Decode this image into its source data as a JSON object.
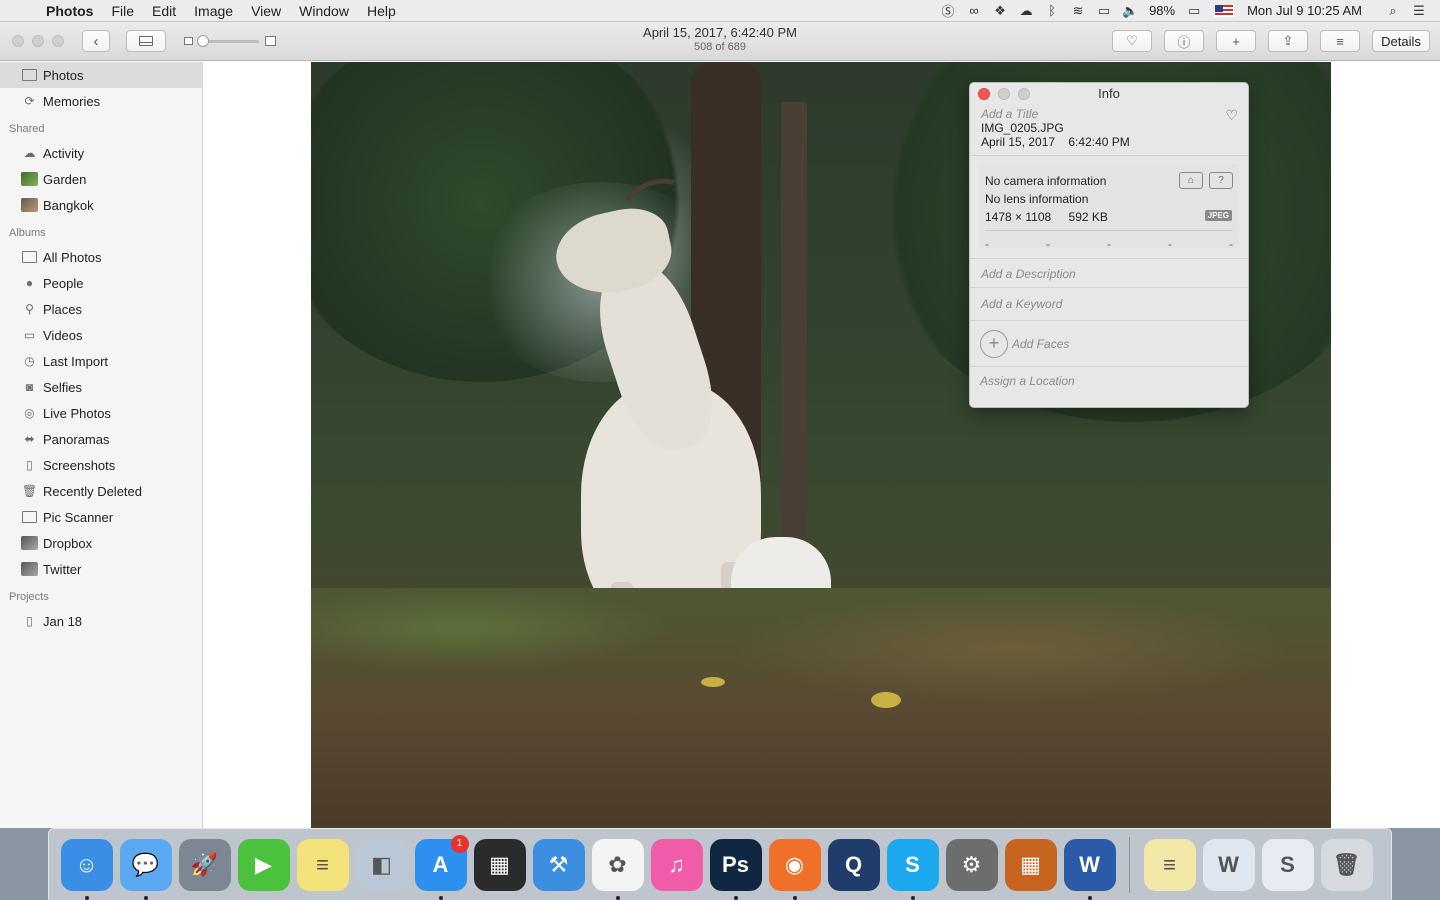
{
  "menubar": {
    "app_name": "Photos",
    "menus": [
      "File",
      "Edit",
      "Image",
      "View",
      "Window",
      "Help"
    ],
    "battery": "98%",
    "clock": "Mon Jul 9  10:25 AM"
  },
  "toolbar": {
    "photo_date": "April 15, 2017, 6:42:40 PM",
    "photo_position": "508 of 689",
    "details_label": "Details"
  },
  "sidebar": {
    "library": [
      {
        "label": "Photos",
        "icon": "photos-library-icon"
      },
      {
        "label": "Memories",
        "icon": "memories-icon"
      }
    ],
    "shared_header": "Shared",
    "shared": [
      {
        "label": "Activity",
        "icon": "cloud-icon"
      },
      {
        "label": "Garden",
        "icon": "album-thumb-icon"
      },
      {
        "label": "Bangkok",
        "icon": "album-thumb-icon"
      }
    ],
    "albums_header": "Albums",
    "albums": [
      {
        "label": "All Photos",
        "icon": "album-icon"
      },
      {
        "label": "People",
        "icon": "person-icon"
      },
      {
        "label": "Places",
        "icon": "pin-icon"
      },
      {
        "label": "Videos",
        "icon": "video-icon"
      },
      {
        "label": "Last Import",
        "icon": "clock-icon"
      },
      {
        "label": "Selfies",
        "icon": "camera-icon"
      },
      {
        "label": "Live Photos",
        "icon": "live-photo-icon"
      },
      {
        "label": "Panoramas",
        "icon": "panorama-icon"
      },
      {
        "label": "Screenshots",
        "icon": "screenshot-icon"
      },
      {
        "label": "Recently Deleted",
        "icon": "trash-icon"
      },
      {
        "label": "Pic Scanner",
        "icon": "album-icon"
      },
      {
        "label": "Dropbox",
        "icon": "album-thumb-icon"
      },
      {
        "label": "Twitter",
        "icon": "album-thumb-icon"
      }
    ],
    "projects_header": "Projects",
    "projects": [
      {
        "label": "Jan 18",
        "icon": "project-icon"
      }
    ]
  },
  "info_panel": {
    "title": "Info",
    "title_placeholder": "Add a Title",
    "filename": "IMG_0205.JPG",
    "datetime": "April 15, 2017    6:42:40 PM",
    "camera": "No camera information",
    "lens": "No lens information",
    "dimensions": "1478 × 1108",
    "filesize": "592 KB",
    "format_badge": "JPEG",
    "exif_dashes": [
      "-",
      "-",
      "-",
      "-",
      "-"
    ],
    "description_placeholder": "Add a Description",
    "keyword_placeholder": "Add a Keyword",
    "faces_label": "Add Faces",
    "location_placeholder": "Assign a Location"
  },
  "dock": {
    "apps": [
      {
        "name": "Finder",
        "icon": "finder-icon",
        "color": "#3a8ee6",
        "glyph": "☺",
        "running": true
      },
      {
        "name": "Messages",
        "icon": "messages-icon",
        "color": "#5aa8f0",
        "glyph": "💬",
        "running": true
      },
      {
        "name": "Launchpad",
        "icon": "rocket-icon",
        "color": "#7d8793",
        "glyph": "🚀",
        "running": false
      },
      {
        "name": "FaceTime",
        "icon": "facetime-icon",
        "color": "#4cc13e",
        "glyph": "▶",
        "running": false
      },
      {
        "name": "Notes",
        "icon": "notes-icon",
        "color": "#f4e27a",
        "glyph": "≡",
        "running": false
      },
      {
        "name": "Preview",
        "icon": "preview-icon",
        "color": "#b9c7d6",
        "glyph": "◧",
        "running": false
      },
      {
        "name": "App Store",
        "icon": "app-store-icon",
        "color": "#2d8ff0",
        "glyph": "A",
        "running": true,
        "badge": "1"
      },
      {
        "name": "Final Cut",
        "icon": "clapper-icon",
        "color": "#2b2b2b",
        "glyph": "▦",
        "running": false
      },
      {
        "name": "Xcode",
        "icon": "xcode-icon",
        "color": "#3c8ee0",
        "glyph": "⚒",
        "running": false
      },
      {
        "name": "Photos",
        "icon": "photos-app-icon",
        "color": "#f4f4f4",
        "glyph": "✿",
        "running": true
      },
      {
        "name": "iTunes",
        "icon": "itunes-icon",
        "color": "#f05ca8",
        "glyph": "♫",
        "running": false
      },
      {
        "name": "Photoshop",
        "icon": "photoshop-icon",
        "color": "#0f2740",
        "glyph": "Ps",
        "running": true
      },
      {
        "name": "Firefox",
        "icon": "firefox-icon",
        "color": "#f0702a",
        "glyph": "◉",
        "running": true
      },
      {
        "name": "QuickTime",
        "icon": "quicktime-icon",
        "color": "#1f3c6a",
        "glyph": "Q",
        "running": false
      },
      {
        "name": "Skype",
        "icon": "skype-icon",
        "color": "#1ca8ee",
        "glyph": "S",
        "running": true
      },
      {
        "name": "System Preferences",
        "icon": "gear-icon",
        "color": "#6d6d6d",
        "glyph": "⚙",
        "running": false
      },
      {
        "name": "Calculator",
        "icon": "calculator-icon",
        "color": "#c7641f",
        "glyph": "▦",
        "running": false
      },
      {
        "name": "Word",
        "icon": "word-icon",
        "color": "#2a5aa8",
        "glyph": "W",
        "running": true
      }
    ],
    "docs": [
      {
        "name": "Document stack",
        "icon": "document-stack-icon",
        "color": "#f1e8a8",
        "glyph": "≡"
      },
      {
        "name": "Word doc",
        "icon": "word-document-icon",
        "color": "#dfe6ef",
        "glyph": "W"
      },
      {
        "name": "Skype doc",
        "icon": "skype-document-icon",
        "color": "#e6ecf2",
        "glyph": "S"
      },
      {
        "name": "Trash",
        "icon": "trash-icon",
        "color": "#d7dadd",
        "glyph": "🗑"
      }
    ]
  }
}
